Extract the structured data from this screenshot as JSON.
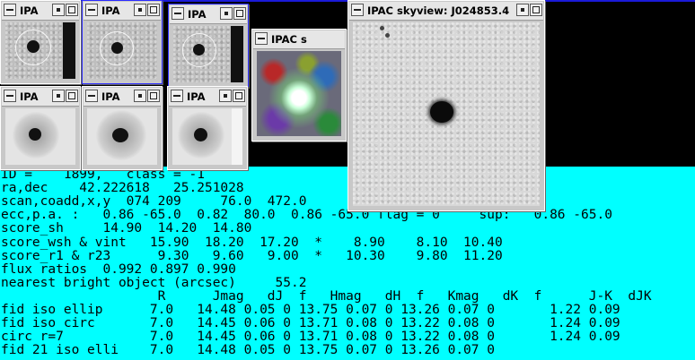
{
  "windows": [
    {
      "id": "w1",
      "title": "IPA"
    },
    {
      "id": "w2",
      "title": "IPA"
    },
    {
      "id": "w3",
      "title": "IPA"
    },
    {
      "id": "w4",
      "title": "IPAC s"
    },
    {
      "id": "w5",
      "title": "IPAC skyview: J024853.4"
    },
    {
      "id": "w6",
      "title": "IPA"
    },
    {
      "id": "w7",
      "title": "IPA"
    },
    {
      "id": "w8",
      "title": "IPA"
    }
  ],
  "console": {
    "lines": [
      "ID =    1899,   class = -1",
      "ra,dec    42.222618   25.251028",
      "scan,coadd,x,y  074 209     76.0  472.0",
      "ecc,p.a. :   0.86 -65.0  0.82  80.0  0.86 -65.0 flag = 0     sup:   0.86 -65.0",
      "score_sh     14.90  14.20  14.80",
      "score_wsh & vint   15.90  18.20  17.20  *    8.90    8.10  10.40",
      "score_r1 & r23      9.30   9.60   9.00  *   10.30    9.80  11.20",
      "flux ratios  0.992 0.897 0.990",
      "nearest bright object (arcsec)     55.2",
      "                    R      Jmag   dJ  f   Hmag   dH  f   Kmag   dK  f      J-K  dJK",
      "fid iso ellip      7.0   14.48 0.05 0 13.75 0.07 0 13.26 0.07 0       1.22 0.09",
      "fid iso circ       7.0   14.45 0.06 0 13.71 0.08 0 13.22 0.08 0       1.24 0.09",
      "circ r=7           7.0   14.45 0.06 0 13.71 0.08 0 13.22 0.08 0       1.24 0.09",
      "fid 21 iso elli    7.0   14.48 0.05 0 13.75 0.07 0 13.26 0.07 0"
    ]
  }
}
